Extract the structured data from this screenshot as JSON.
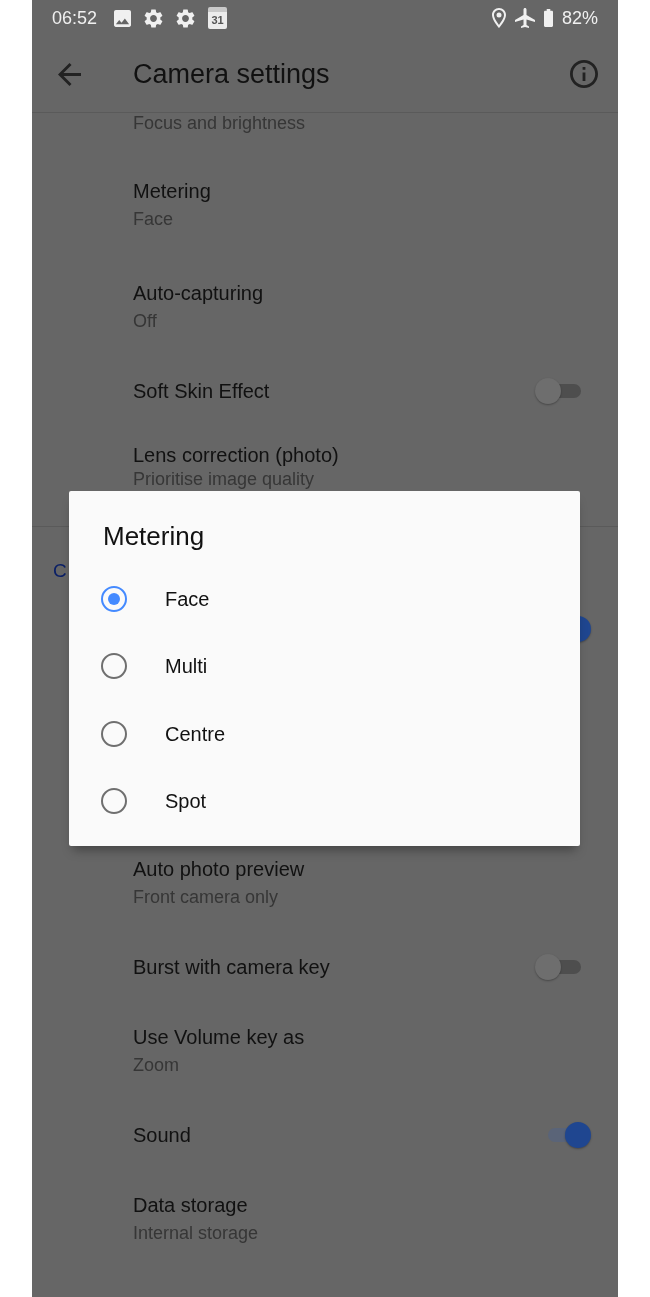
{
  "status_bar": {
    "time": "06:52",
    "calendar_day": "31",
    "battery": "82%"
  },
  "app_bar": {
    "title": "Camera settings"
  },
  "settings": [
    {
      "kind": "value",
      "subtitle": "Focus and brightness"
    },
    {
      "kind": "value",
      "title": "Metering",
      "subtitle": "Face"
    },
    {
      "kind": "value",
      "title": "Auto-capturing",
      "subtitle": "Off"
    },
    {
      "kind": "toggle",
      "title": "Soft Skin Effect",
      "on": false
    },
    {
      "kind": "value",
      "title": "Lens correction (photo)",
      "subtitle": "Prioritise image quality"
    },
    {
      "kind": "header",
      "title": "C"
    },
    {
      "kind": "toggle",
      "on": true
    }
  ],
  "settings_after_dialog": [
    {
      "kind": "value",
      "title": "Auto photo preview",
      "subtitle": "Front camera only"
    },
    {
      "kind": "toggle",
      "title": "Burst with camera key",
      "on": false
    },
    {
      "kind": "value",
      "title": "Use Volume key as",
      "subtitle": "Zoom"
    },
    {
      "kind": "toggle",
      "title": "Sound",
      "on": true
    },
    {
      "kind": "value",
      "title": "Data storage",
      "subtitle": "Internal storage"
    }
  ],
  "metering_dialog": {
    "title": "Metering",
    "options": [
      {
        "label": "Face",
        "selected": true
      },
      {
        "label": "Multi",
        "selected": false
      },
      {
        "label": "Centre",
        "selected": false
      },
      {
        "label": "Spot",
        "selected": false
      }
    ]
  }
}
